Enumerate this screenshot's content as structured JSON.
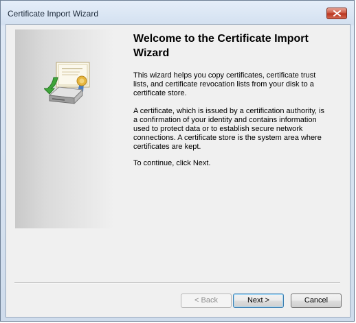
{
  "window": {
    "title": "Certificate Import Wizard"
  },
  "side_panel": {
    "icon": "certificate-import-icon"
  },
  "content": {
    "heading": "Welcome to the Certificate Import Wizard",
    "paragraphs": [
      "This wizard helps you copy certificates, certificate trust lists, and certificate revocation lists from your disk to a certificate store.",
      "A certificate, which is issued by a certification authority, is a confirmation of your identity and contains information used to protect data or to establish secure network connections. A certificate store is the system area where certificates are kept.",
      "To continue, click Next."
    ]
  },
  "buttons": {
    "back": "< Back",
    "next": "Next >",
    "cancel": "Cancel"
  },
  "colors": {
    "title_bar": "#dfe9f5",
    "close_button": "#c8513b",
    "dialog_bg": "#f0f0f0",
    "default_button_border": "#3c7fb1"
  }
}
